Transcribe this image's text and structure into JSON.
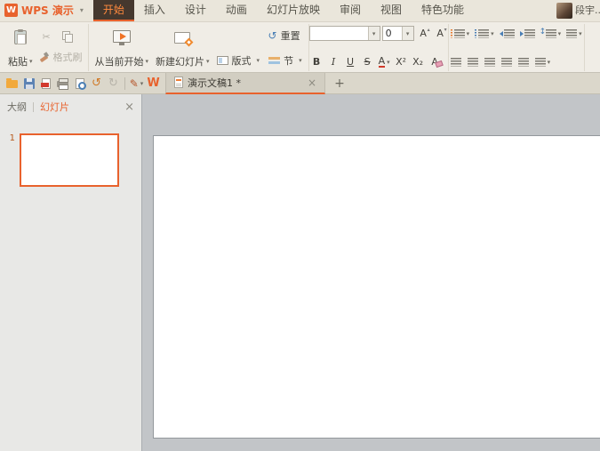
{
  "colors": {
    "accent": "#e8622d",
    "active_tab_bg": "#45382e",
    "active_tab_text": "#ff8a3e",
    "titlebar_bg": "#eae6db",
    "ribbon_bg": "#f0ede6",
    "docbar_bg": "#dbd7cb",
    "sidebar_bg": "#e8e8e6",
    "canvas_bg": "#c2c5c8",
    "slide_bg": "#ffffff"
  },
  "icons": {
    "cut": "✂",
    "undo": "↺",
    "redo": "↻",
    "pen": "✎",
    "reset_arrow": "↺",
    "close": "×",
    "plus": "+",
    "caret": "▾",
    "wps_letter": "W",
    "logo_letter": "W"
  },
  "titlebar": {
    "app_name": "WPS 演示",
    "user_name": "段宇...",
    "tabs": [
      {
        "id": "home",
        "label": "开始",
        "active": true
      },
      {
        "id": "insert",
        "label": "插入",
        "active": false
      },
      {
        "id": "design",
        "label": "设计",
        "active": false
      },
      {
        "id": "animation",
        "label": "动画",
        "active": false
      },
      {
        "id": "slideshow",
        "label": "幻灯片放映",
        "active": false
      },
      {
        "id": "review",
        "label": "审阅",
        "active": false
      },
      {
        "id": "view",
        "label": "视图",
        "active": false
      },
      {
        "id": "special",
        "label": "特色功能",
        "active": false
      }
    ]
  },
  "ribbon": {
    "paste": "粘贴",
    "format_painter": "格式刷",
    "from_current": "从当前开始",
    "new_slide": "新建幻灯片",
    "reset": "重置",
    "layout": "版式",
    "section": "节",
    "font_name": "",
    "font_size": "0",
    "bold": "B",
    "italic": "I",
    "underline": "U",
    "strike": "S",
    "font_color": "A",
    "grow_font": "A",
    "shrink_font": "A",
    "superscript": "X²",
    "subscript": "X₂",
    "clear_format": "A"
  },
  "docbar": {
    "doc_tab_label": "演示文稿1 *"
  },
  "sidebar": {
    "outline_tab": "大纲",
    "slides_tab": "幻灯片",
    "slides": [
      {
        "number": "1"
      }
    ]
  }
}
